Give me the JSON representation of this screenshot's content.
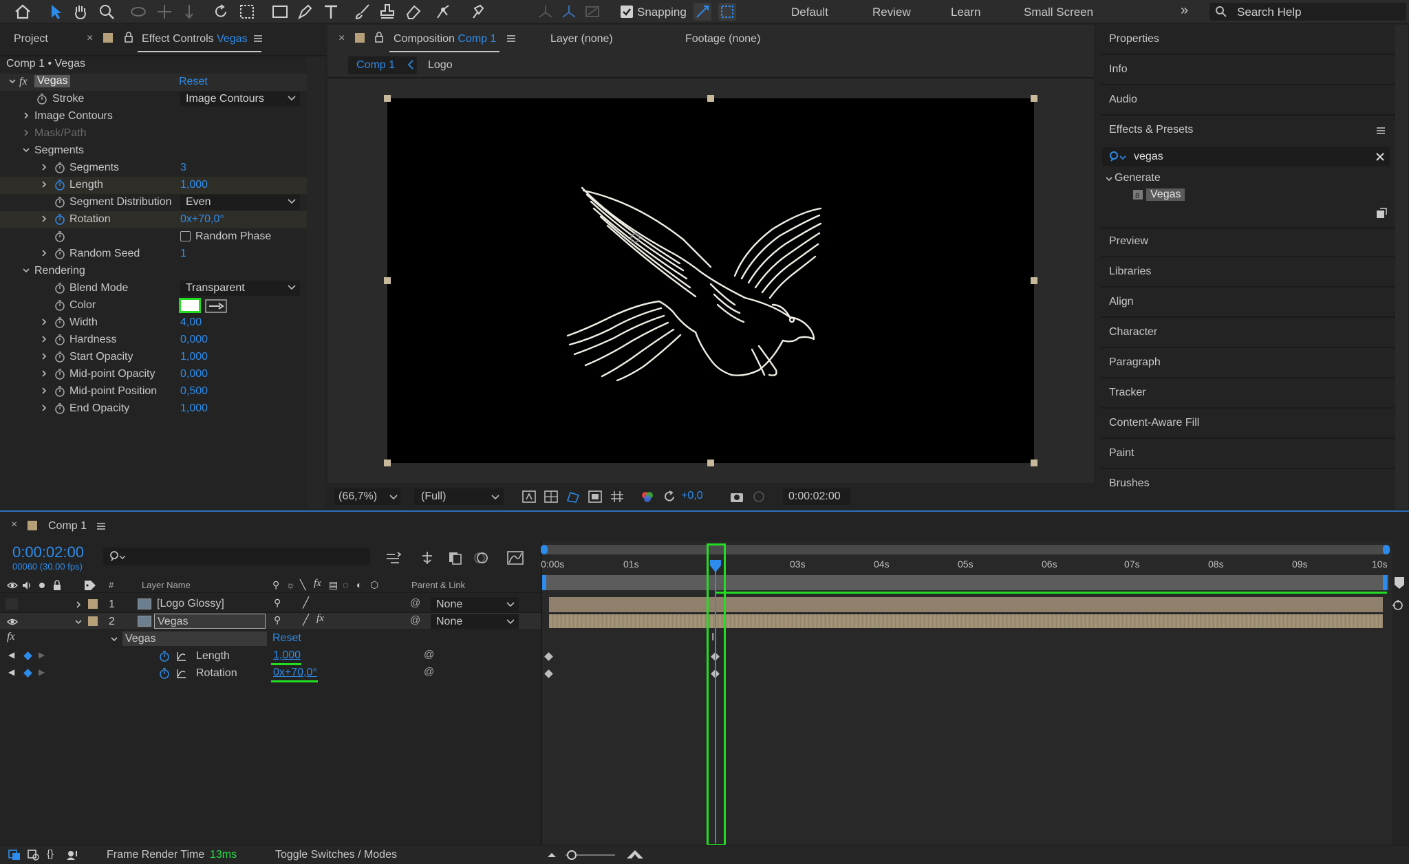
{
  "toolbar": {
    "snapping_label": "Snapping",
    "workspaces": [
      "Default",
      "Review",
      "Learn",
      "Small Screen"
    ],
    "search_placeholder": "Search Help",
    "icons": [
      "home-icon",
      "selection-icon",
      "hand-icon",
      "zoom-icon",
      "orbit-icon",
      "pan-icon",
      "dolly-icon",
      "rotate-icon",
      "pan-behind-icon",
      "rectangle-icon",
      "pen-icon",
      "type-icon",
      "brush-icon",
      "clone-stamp-icon",
      "eraser-icon",
      "roto-brush-icon",
      "puppet-pin-icon"
    ]
  },
  "left_panel": {
    "tab_project": "Project",
    "tab_effect_controls": "Effect Controls",
    "tab_effect_controls_layer": "Vegas",
    "breadcrumb": "Comp 1 • Vegas",
    "effect_name": "Vegas",
    "reset_label": "Reset",
    "rows": {
      "stroke_label": "Stroke",
      "stroke_value": "Image Contours",
      "image_contours": "Image Contours",
      "mask_path": "Mask/Path",
      "segments_group": "Segments",
      "segments_label": "Segments",
      "segments_value": "3",
      "length_label": "Length",
      "length_value": "1,000",
      "seg_dist_label": "Segment Distribution",
      "seg_dist_value": "Even",
      "rotation_label": "Rotation",
      "rotation_value": "0x+70,0°",
      "random_phase": "Random Phase",
      "random_seed_label": "Random Seed",
      "random_seed_value": "1",
      "rendering_group": "Rendering",
      "blend_label": "Blend Mode",
      "blend_value": "Transparent",
      "color_label": "Color",
      "width_label": "Width",
      "width_value": "4,00",
      "hardness_label": "Hardness",
      "hardness_value": "0,000",
      "start_op_label": "Start Opacity",
      "start_op_value": "1,000",
      "mid_op_label": "Mid-point Opacity",
      "mid_op_value": "0,000",
      "mid_pos_label": "Mid-point Position",
      "mid_pos_value": "0,500",
      "end_op_label": "End Opacity",
      "end_op_value": "1,000"
    },
    "color_swatch": "#ffffff"
  },
  "comp_panel": {
    "tab_composition": "Composition",
    "tab_composition_name": "Comp 1",
    "tab_layer": "Layer (none)",
    "tab_footage": "Footage (none)",
    "breadcrumb_active": "Comp 1",
    "breadcrumb_next": "Logo",
    "zoom": "(66,7%)",
    "resolution": "(Full)",
    "exposure": "+0,0",
    "timecode": "0:00:02:00"
  },
  "right_panel": {
    "items_top": [
      "Properties",
      "Info",
      "Audio"
    ],
    "effects_presets": "Effects & Presets",
    "search_value": "vegas",
    "category": "Generate",
    "result": "Vegas",
    "items_bottom": [
      "Preview",
      "Libraries",
      "Align",
      "Character",
      "Paragraph",
      "Tracker",
      "Content-Aware Fill",
      "Paint",
      "Brushes"
    ]
  },
  "timeline": {
    "tab_name": "Comp 1",
    "timecode": "0:00:02:00",
    "frame_info": "00060 (30.00 fps)",
    "col_num": "#",
    "col_layer_name": "Layer Name",
    "col_parent": "Parent & Link",
    "layers": [
      {
        "num": "1",
        "name": "[Logo Glossy]",
        "parent": "None"
      },
      {
        "num": "2",
        "name": "Vegas",
        "parent": "None"
      }
    ],
    "effect_name": "Vegas",
    "reset_label": "Reset",
    "props": [
      {
        "name": "Length",
        "value": "1,000"
      },
      {
        "name": "Rotation",
        "value": "0x+70,0°"
      }
    ],
    "ruler": [
      "0:00s",
      "01s",
      "03s",
      "04s",
      "05s",
      "06s",
      "07s",
      "08s",
      "09s",
      "10s"
    ],
    "footer_render_label": "Frame Render Time",
    "footer_render_value": "13ms",
    "footer_toggle": "Toggle Switches / Modes"
  },
  "colors": {
    "accent": "#2d8ceb",
    "highlight_green": "#22dd22",
    "layer_bar": "#8e806b",
    "label_tan": "#b5a07a"
  }
}
